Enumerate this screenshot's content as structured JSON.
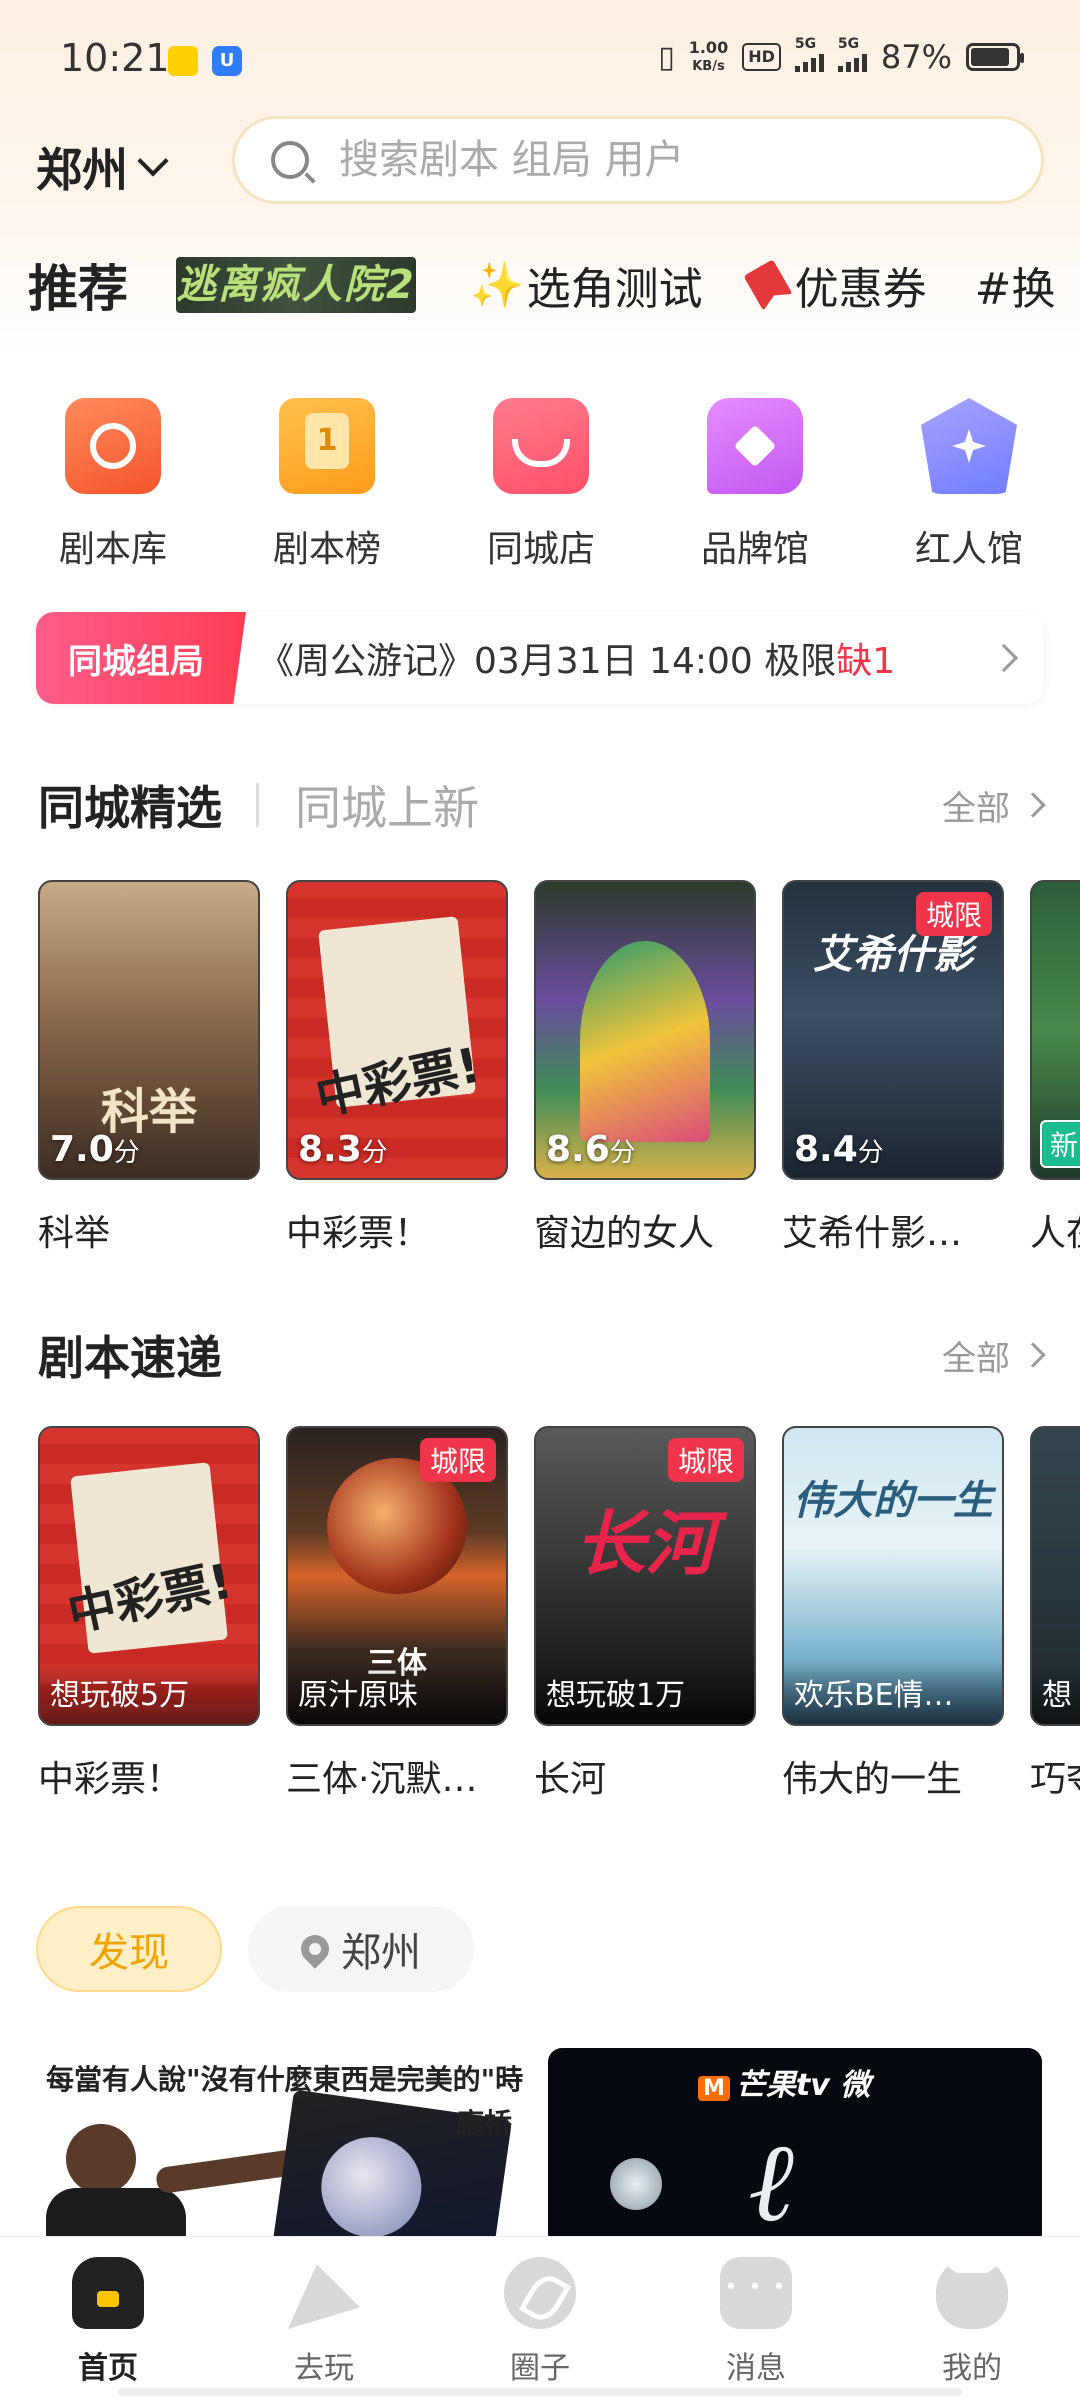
{
  "status_bar": {
    "time": "10:21",
    "app_badge_1": "美团",
    "net_speed_top": "1.00",
    "net_speed_unit": "KB/s",
    "hd_label": "HD",
    "signal_1": "5G",
    "signal_2": "5G",
    "battery": "87%"
  },
  "header": {
    "city": "郑州",
    "search_placeholder": "搜索剧本 组局 用户"
  },
  "top_tabs": [
    {
      "label": "推荐",
      "active": true
    },
    {
      "label": "逃离疯人院2"
    },
    {
      "label": "选角测试",
      "emoji": "✨"
    },
    {
      "label": "优惠券"
    },
    {
      "label": "#换"
    }
  ],
  "quick_entries": [
    {
      "label": "剧本库",
      "icon": "script-library-icon"
    },
    {
      "label": "剧本榜",
      "icon": "ranking-icon",
      "badge": "1"
    },
    {
      "label": "同城店",
      "icon": "local-store-icon"
    },
    {
      "label": "品牌馆",
      "icon": "brand-hall-icon"
    },
    {
      "label": "红人馆",
      "icon": "influencer-hall-icon"
    }
  ],
  "group_bar": {
    "tag": "同城组局",
    "text": "《周公游记》03月31日 14:00 极限",
    "missing": "缺1"
  },
  "section_local": {
    "title": "同城精选",
    "title_alt": "同城上新",
    "all": "全部",
    "cards": [
      {
        "name": "科举",
        "score": "7.0",
        "unit": "分",
        "poster_text": "科举"
      },
      {
        "name": "中彩票！",
        "score": "8.3",
        "unit": "分",
        "poster_text": "中彩票!"
      },
      {
        "name": "窗边的女人",
        "score": "8.6",
        "unit": "分",
        "poster_text": ""
      },
      {
        "name": "艾希什影…",
        "score": "8.4",
        "unit": "分",
        "tag": "城限",
        "poster_text": "艾希什影"
      },
      {
        "name": "人在",
        "tag_new": "新",
        "poster_text": ""
      }
    ]
  },
  "section_express": {
    "title": "剧本速递",
    "all": "全部",
    "cards": [
      {
        "name": "中彩票！",
        "hot": "想玩破5万"
      },
      {
        "name": "三体·沉默…",
        "hot": "原汁原味",
        "tag": "城限",
        "poster_text": "三体"
      },
      {
        "name": "长河",
        "hot": "想玩破1万",
        "tag": "城限",
        "poster_text": "长河"
      },
      {
        "name": "伟大的一生",
        "hot": "欢乐BE情…",
        "poster_text": "伟大的一生"
      },
      {
        "name": "巧夺",
        "hot": "想"
      }
    ]
  },
  "discover": {
    "tab_active": "发现",
    "tab_city": "郑州",
    "feed_a_caption": "每當有人說\"沒有什麼東西是完美的\"時",
    "feed_a_sticker": "廊桥",
    "feed_b_brand": "芒果tv",
    "feed_b_brand_mark": "M",
    "feed_b_extra": "微"
  },
  "bottom_nav": [
    {
      "label": "首页",
      "active": true
    },
    {
      "label": "去玩"
    },
    {
      "label": "圈子"
    },
    {
      "label": "消息"
    },
    {
      "label": "我的"
    }
  ]
}
